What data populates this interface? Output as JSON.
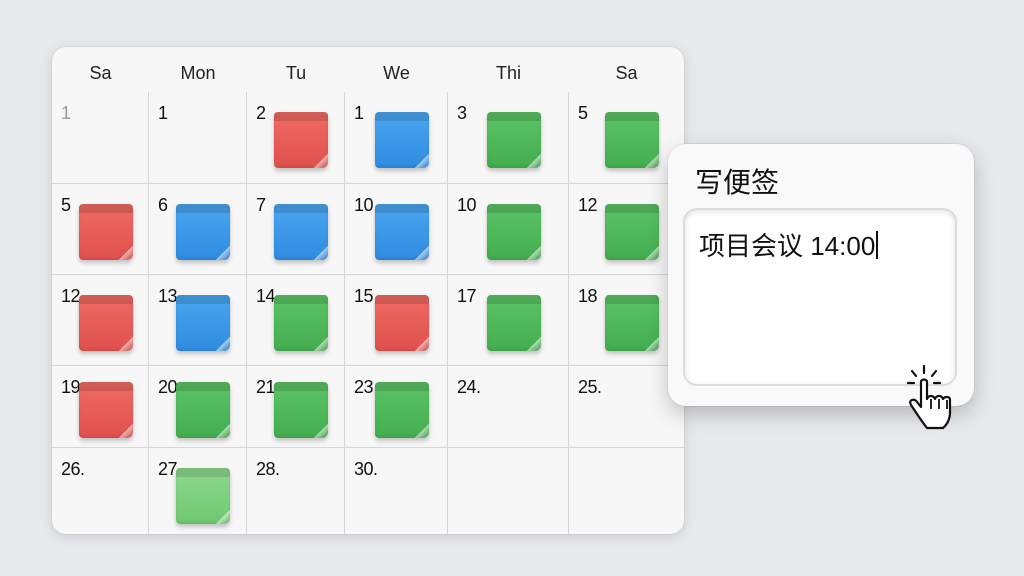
{
  "calendar": {
    "weekdays": [
      "Sa",
      "Mon",
      "Tu",
      "We",
      "Thi",
      "Sa"
    ],
    "weeks": [
      [
        {
          "day": "1",
          "muted": true,
          "note": null
        },
        {
          "day": "1",
          "note": null
        },
        {
          "day": "2",
          "note": "red"
        },
        {
          "day": "1",
          "note": "blue"
        },
        {
          "day": "3",
          "note": "green"
        },
        {
          "day": "5",
          "note": "green"
        }
      ],
      [
        {
          "day": "5",
          "note": "red"
        },
        {
          "day": "6",
          "note": "blue"
        },
        {
          "day": "7",
          "note": "blue"
        },
        {
          "day": "10",
          "note": "blue"
        },
        {
          "day": "10",
          "note": "green"
        },
        {
          "day": "12",
          "note": "green"
        }
      ],
      [
        {
          "day": "12",
          "note": "red"
        },
        {
          "day": "13",
          "note": "blue"
        },
        {
          "day": "14",
          "note": "green"
        },
        {
          "day": "15",
          "note": "red"
        },
        {
          "day": "17",
          "note": "green"
        },
        {
          "day": "18",
          "note": "green"
        }
      ],
      [
        {
          "day": "19",
          "note": "red"
        },
        {
          "day": "20",
          "note": "green"
        },
        {
          "day": "21",
          "note": "green"
        },
        {
          "day": "23",
          "note": "green"
        },
        {
          "day": "24.",
          "note": null
        },
        {
          "day": "25.",
          "note": null
        }
      ],
      [
        {
          "day": "26.",
          "note": null
        },
        {
          "day": "27",
          "note": "lightgreen"
        },
        {
          "day": "28.",
          "note": null
        },
        {
          "day": "30.",
          "note": null
        },
        {
          "day": "",
          "note": null
        },
        {
          "day": "",
          "note": null
        }
      ]
    ]
  },
  "note_colors": {
    "red": "#e75a55",
    "blue": "#3a97e8",
    "green": "#4fb95a",
    "lightgreen": "#7ccf7e"
  },
  "popup": {
    "title": "写便签",
    "input_value": "项目会议 14:00"
  },
  "cursor_icon": "hand-pointer-click-icon"
}
